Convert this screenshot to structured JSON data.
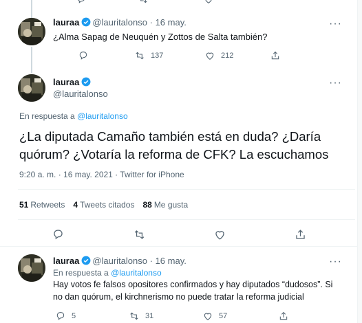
{
  "top_tweet": {
    "name": "lauraa",
    "handle": "@lauritalonso",
    "date": "16 may.",
    "text": "¿Alma Sapag de Neuquén y Zottos de Salta también?",
    "replies": "",
    "retweets": "137",
    "likes": "212"
  },
  "main_tweet": {
    "name": "lauraa",
    "handle": "@lauritalonso",
    "reply_prefix": "En respuesta a",
    "reply_to": "@lauritalonso",
    "text": "¿La diputada Camaño también está en duda? ¿Daría quórum? ¿Votaría la reforma de CFK? La escuchamos",
    "meta": "9:20 a. m. · 16 may. 2021 · Twitter for iPhone",
    "stats": {
      "retweets_count": "51",
      "retweets_label": "Retweets",
      "quotes_count": "4",
      "quotes_label": "Tweets citados",
      "likes_count": "88",
      "likes_label": "Me gusta"
    }
  },
  "reply_tweet": {
    "name": "lauraa",
    "handle": "@lauritalonso",
    "date": "16 may.",
    "reply_prefix": "En respuesta a",
    "reply_to": "@lauritalonso",
    "text": "Hay votos fe falsos opositores confirmados y hay diputados “dudosos”. Si no dan quórum, el kirchnerismo no puede tratar la reforma judicial",
    "replies": "5",
    "retweets": "31",
    "likes": "57"
  },
  "colors": {
    "accent": "#1d9bf0",
    "text": "#0f1419",
    "muted": "#536471",
    "divider": "#eff3f4"
  }
}
